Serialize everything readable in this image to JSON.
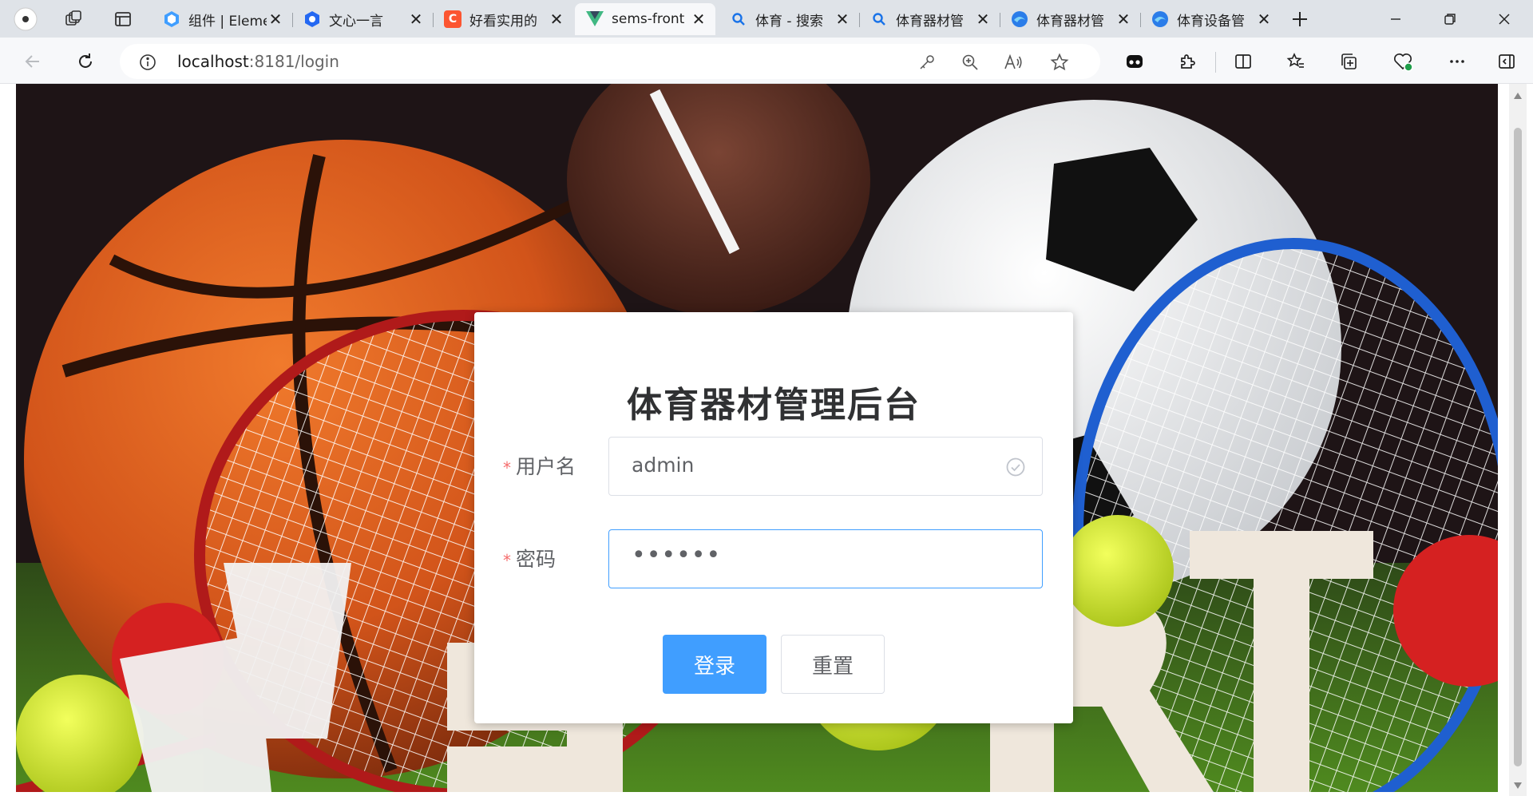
{
  "browser": {
    "tabs": [
      {
        "title": "组件 | Element",
        "favicon": "element-hex-icon",
        "color": "#409eff",
        "active": false
      },
      {
        "title": "文心一言",
        "favicon": "wenxin-icon",
        "color": "#2468f2",
        "active": false
      },
      {
        "title": "好看实用的",
        "favicon": "c-logo-icon",
        "color": "#fc5531",
        "active": false
      },
      {
        "title": "sems-front",
        "favicon": "vue-icon",
        "color": "#41b883",
        "active": true
      },
      {
        "title": "体育 - 搜索",
        "favicon": "search-icon",
        "color": "#1a73e8",
        "active": false
      },
      {
        "title": "体育器材管",
        "favicon": "search-icon",
        "color": "#1a73e8",
        "active": false
      },
      {
        "title": "体育器材管",
        "favicon": "edge-globe-icon",
        "color": "#2b7de9",
        "active": false
      },
      {
        "title": "体育设备管",
        "favicon": "edge-globe-icon",
        "color": "#2b7de9",
        "active": false
      }
    ],
    "url_host": "localhost",
    "url_rest": ":8181/login"
  },
  "login": {
    "title": "体育器材管理后台",
    "username_label": "用户名",
    "username_value": "admin",
    "password_label": "密码",
    "password_mask": "••••••",
    "required_mark": "*",
    "login_button": "登录",
    "reset_button": "重置"
  },
  "colors": {
    "primary": "#409eff",
    "required": "#f56c6c",
    "success": "#67c23a"
  }
}
